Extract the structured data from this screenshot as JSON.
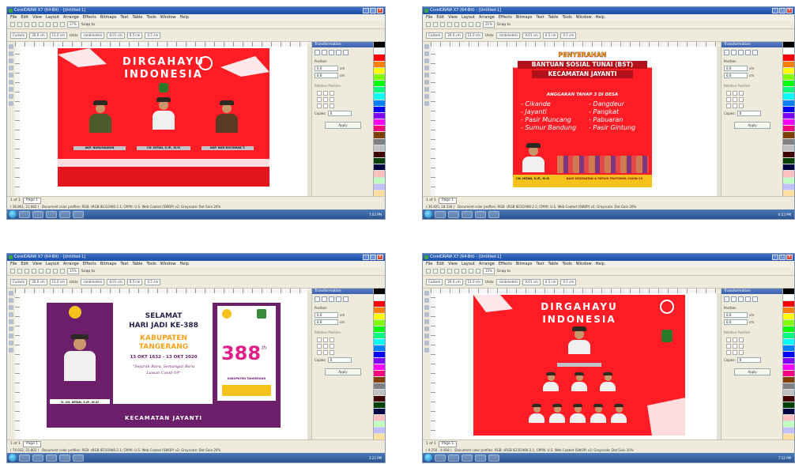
{
  "screens": [
    {
      "window_title": "CorelDRAW X7 (64-Bit) - [Untitled-1]",
      "menu": [
        "File",
        "Edit",
        "View",
        "Layout",
        "Arrange",
        "Effects",
        "Bitmaps",
        "Text",
        "Table",
        "Tools",
        "Window",
        "Help"
      ],
      "zoom": "37%",
      "snap_label": "Snap to",
      "preset": "Custom",
      "page_width": "20.0 cm",
      "page_height": "11.0 cm",
      "units_label": "Units:",
      "units": "centimeters",
      "nudge": "0.01 cm",
      "dup_x": "0.5 cm",
      "dup_y": "0.5 cm",
      "docker_title": "Transformation",
      "docker_position_label": "Position",
      "docker_x": "0.0",
      "docker_y": "0.0",
      "docker_unit": "cm",
      "docker_relative": "Relative Position",
      "docker_copies_label": "Copies:",
      "docker_copies": "0",
      "docker_apply": "Apply",
      "page_counter": "1 of 1",
      "page_tab": "Page 1",
      "cursor_coords": "( 36.861, 21.082 )",
      "status": "Document color profiles: RGB: sRGB IEC61966-2.1; CMYK: U.S. Web Coated (SWOP) v2; Grayscale: Dot Gain 20%",
      "clock": "7:03 PM",
      "design": {
        "headline_1": "DIRGAHAYU",
        "headline_2": "INDONESIA",
        "names": [
          "AKP. NURUHADDIN",
          "CH. INTAN, S.IP., M.SI",
          "AKP. NUR ROCHMAN T."
        ]
      }
    },
    {
      "window_title": "CorelDRAW X7 (64-Bit) - [Untitled-1]",
      "menu": [
        "File",
        "Edit",
        "View",
        "Layout",
        "Arrange",
        "Effects",
        "Bitmaps",
        "Text",
        "Table",
        "Tools",
        "Window",
        "Help"
      ],
      "zoom": "21%",
      "snap_label": "Snap to",
      "preset": "Custom",
      "page_width": "20.0 cm",
      "page_height": "11.0 cm",
      "units_label": "Units:",
      "units": "centimeters",
      "nudge": "0.01 cm",
      "dup_x": "0.5 cm",
      "dup_y": "0.5 cm",
      "docker_title": "Transformation",
      "docker_position_label": "Position",
      "docker_x": "0.0",
      "docker_y": "0.0",
      "docker_unit": "cm",
      "docker_relative": "Relative Position",
      "docker_copies_label": "Copies:",
      "docker_copies": "0",
      "docker_apply": "Apply",
      "page_counter": "1 of 1",
      "page_tab": "Page 1",
      "cursor_coords": "( 36.925, 18.336 )",
      "status": "Document color profiles: RGB: sRGB IEC61966-2.1; CMYK: U.S. Web Coated (SWOP) v2; Grayscale: Dot Gain 20%",
      "clock": "6:53 PM",
      "design": {
        "headline_1": "PENYERAHAN",
        "headline_2": "BANTUAN SOSIAL TUNAI (BST)",
        "headline_3": "KECAMATAN JAYANTI",
        "subtitle": "ANGGARAN TAHAP 3 DI DESA",
        "villages_left": [
          "- Cikande",
          "- Jayanti",
          "- Pasir Muncang",
          "- Sumur Bandung"
        ],
        "villages_right": [
          "- Dangdeur",
          "- Pangkat",
          "- Pabuaran",
          "- Pasir Gintung"
        ],
        "name_plate": "CH. INTAN, S.IP., M.SI",
        "footer": "BAGI KESEHATAN & PATUHI PROTOKOL COVID-19"
      }
    },
    {
      "window_title": "CorelDRAW X7 (64-Bit) - [Untitled-1]",
      "menu": [
        "File",
        "Edit",
        "View",
        "Layout",
        "Arrange",
        "Effects",
        "Bitmaps",
        "Text",
        "Table",
        "Tools",
        "Window",
        "Help"
      ],
      "zoom": "15%",
      "snap_label": "Snap to",
      "preset": "Custom",
      "page_width": "20.0 cm",
      "page_height": "11.0 cm",
      "units_label": "Units:",
      "units": "centimeters",
      "nudge": "0.01 cm",
      "dup_x": "0.5 cm",
      "dup_y": "0.5 cm",
      "docker_title": "Transformation",
      "docker_position_label": "Position",
      "docker_x": "0.0",
      "docker_y": "0.0",
      "docker_unit": "cm",
      "docker_relative": "Relative Position",
      "docker_copies_label": "Copies:",
      "docker_copies": "0",
      "docker_apply": "Apply",
      "page_counter": "1 of 1",
      "page_tab": "Page 1",
      "cursor_coords": "( 74.932, 23.802 )",
      "status": "Document color profiles: RGB: sRGB IEC61966-2.1; CMYK: U.S. Web Coated (SWOP) v2; Grayscale: Dot Gain 20%",
      "clock": "3:22 PM",
      "design": {
        "headline_1": "SELAMAT",
        "headline_2": "HARI JADI KE-388",
        "headline_3": "KABUPATEN",
        "headline_4": "TANGERANG",
        "dates": "13 OKT 1632 - 13 OKT 2020",
        "tagline_1": "\"Sejarah Baru, Semangat Baru",
        "tagline_2": "Lawan Covid-19\"",
        "name_plate": "H. CH. INTAN, S.IP., M.SI",
        "anniv_number": "388",
        "anniv_suffix": "th",
        "anniv_region": "KABUPATEN TANGERANG",
        "footer": "KECAMATAN JAYANTI"
      }
    },
    {
      "window_title": "CorelDRAW X7 (64-Bit) - [Untitled-1]",
      "menu": [
        "File",
        "Edit",
        "View",
        "Layout",
        "Arrange",
        "Effects",
        "Bitmaps",
        "Text",
        "Table",
        "Tools",
        "Window",
        "Help"
      ],
      "zoom": "15%",
      "snap_label": "Snap to",
      "preset": "Custom",
      "page_width": "20.0 cm",
      "page_height": "11.0 cm",
      "units_label": "Units:",
      "units": "centimeters",
      "nudge": "0.01 cm",
      "dup_x": "0.5 cm",
      "dup_y": "0.5 cm",
      "docker_title": "Transformation",
      "docker_position_label": "Position",
      "docker_x": "0.0",
      "docker_y": "0.0",
      "docker_unit": "cm",
      "docker_relative": "Relative Position",
      "docker_copies_label": "Copies:",
      "docker_copies": "0",
      "docker_apply": "Apply",
      "page_counter": "1 of 1",
      "page_tab": "Page 1",
      "cursor_coords": "( 9.250, -4.918 )",
      "status": "Document color profiles: RGB: sRGB IEC61966-2.1; CMYK: U.S. Web Coated (SWOP) v2; Grayscale: Dot Gain 20%",
      "clock": "7:12 PM",
      "design": {
        "headline_1": "DIRGAHAYU",
        "headline_2": "INDONESIA"
      }
    }
  ],
  "colors": {
    "banner_red": "#ff1c24",
    "purple": "#6b1f6b",
    "gold": "#f4c21b"
  }
}
